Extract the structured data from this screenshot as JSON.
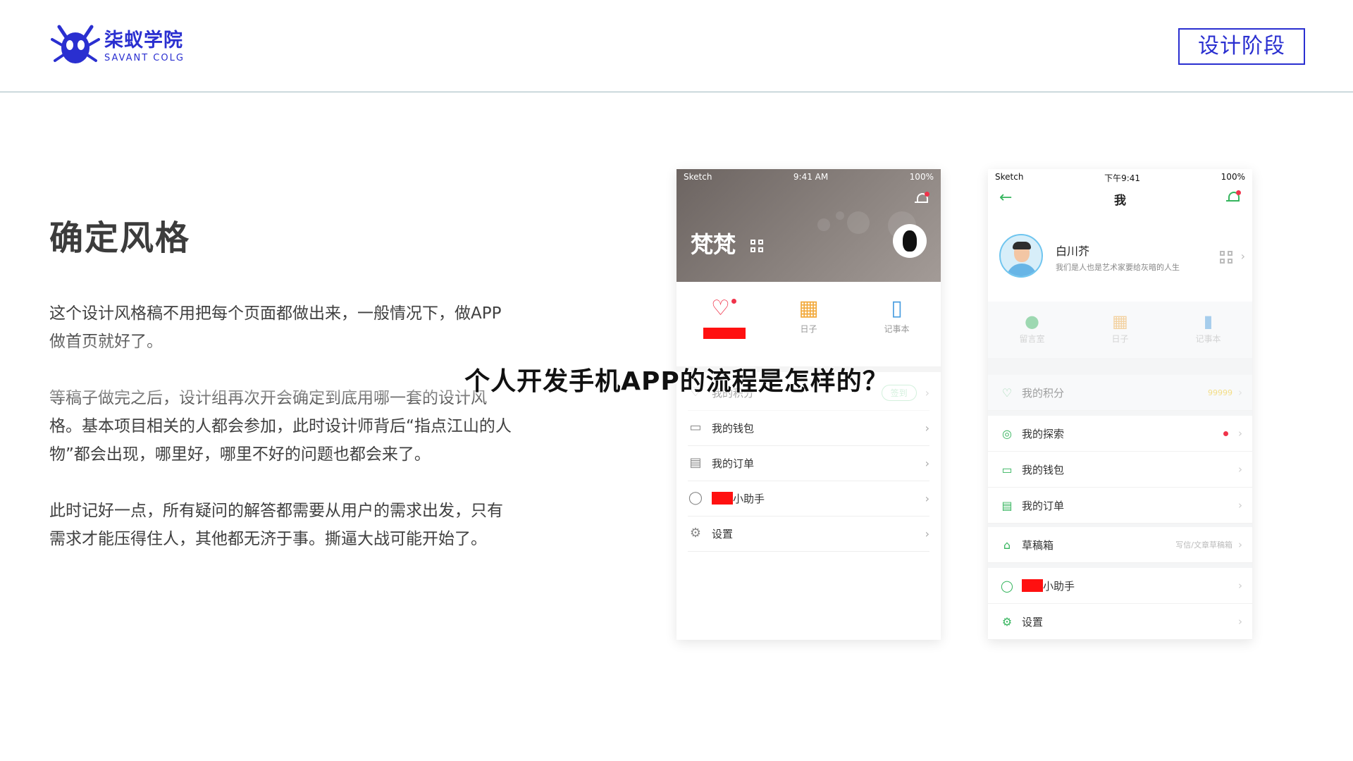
{
  "header": {
    "logo_cn": "柒蚁学院",
    "logo_en": "SAVANT COLG",
    "stage_label": "设计阶段"
  },
  "content": {
    "title": "确定风格",
    "paragraphs": [
      "这个设计风格稿不用把每个页面都做出来，一般情况下，做APP做首页就好了。",
      "等稿子做完之后，设计组再次开会确定到底用哪一套的设计风格。基本项目相关的人都会参加，此时设计师背后“指点江山的人物”都会出现，哪里好，哪里不好的问题也都会来了。",
      "此时记好一点，所有疑问的解答都需要从用户的需求出发，只有需求才能压得住人，其他都无济于事。撕逼大战可能开始了。"
    ]
  },
  "overlay_title": "个人开发手机APP的流程是怎样的？",
  "phone1": {
    "status": {
      "carrier": "Sketch",
      "time": "9:41 AM",
      "battery": "100%"
    },
    "user_name": "梵梵",
    "icons": [
      {
        "icon": "heart-icon",
        "label": ""
      },
      {
        "icon": "calendar-icon",
        "label": "日子"
      },
      {
        "icon": "notebook-icon",
        "label": "记事本"
      }
    ],
    "menu": [
      {
        "icon": "heart-outline-icon",
        "label": "我的积分",
        "badge": "签到"
      },
      {
        "icon": "wallet-icon",
        "label": "我的钱包"
      },
      {
        "icon": "order-icon",
        "label": "我的订单"
      },
      {
        "icon": "chat-icon",
        "label": "小助手"
      },
      {
        "icon": "settings-icon",
        "label": "设置"
      }
    ],
    "accent_color": "#f0334a"
  },
  "phone2": {
    "status": {
      "carrier": "Sketch",
      "time": "下午9:41",
      "battery": "100%"
    },
    "nav_title": "我",
    "user_name": "白川芥",
    "user_bio": "我们是人也是艺术家要给灰暗的人生",
    "icons": [
      {
        "icon": "message-icon",
        "label": "留言室"
      },
      {
        "icon": "calendar-icon",
        "label": "日子"
      },
      {
        "icon": "notebook-icon",
        "label": "记事本"
      }
    ],
    "points": {
      "label": "我的积分",
      "value": "99999"
    },
    "menu_group1": [
      {
        "icon": "explore-icon",
        "label": "我的探索"
      },
      {
        "icon": "wallet-icon",
        "label": "我的钱包"
      },
      {
        "icon": "order-icon",
        "label": "我的订单"
      }
    ],
    "drafts": {
      "label": "草稿箱",
      "extra": "写信/文章草稿箱"
    },
    "menu_group3": [
      {
        "icon": "chat-icon",
        "label": "小助手"
      },
      {
        "icon": "settings-icon",
        "label": "设置"
      }
    ],
    "accent_color": "#36b55e"
  }
}
